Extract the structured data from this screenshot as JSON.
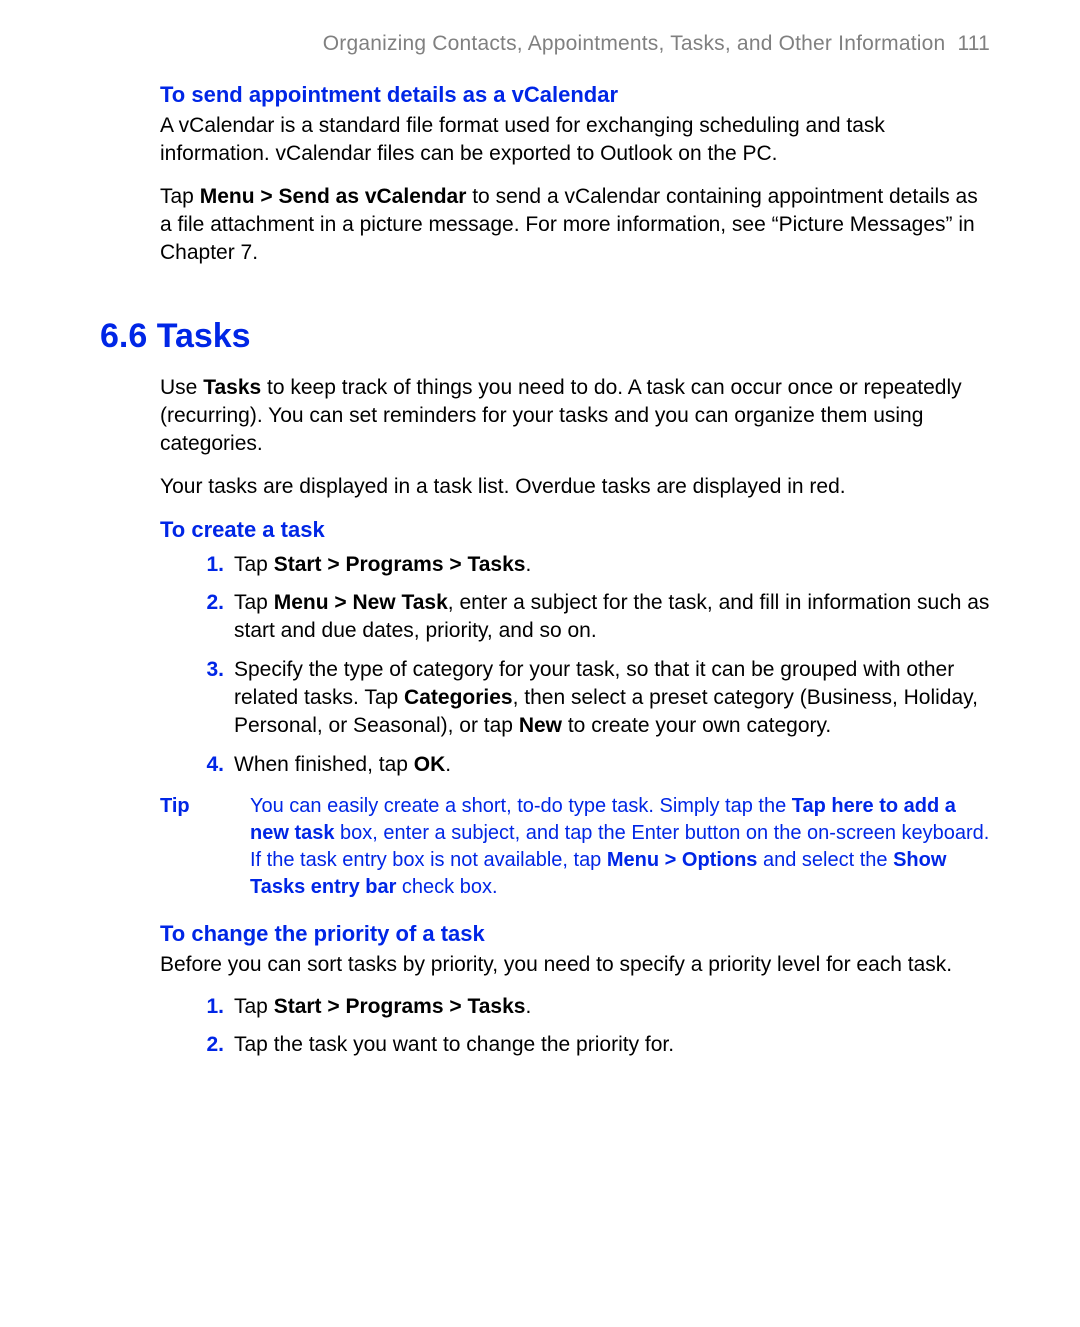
{
  "header": {
    "running_title": "Organizing Contacts, Appointments, Tasks, and Other Information",
    "page_number": "111"
  },
  "vcal": {
    "heading": "To send appointment details as a vCalendar",
    "p1": "A vCalendar is a standard file format used for exchanging scheduling and task information. vCalendar files can be exported to Outlook on the PC.",
    "p2_pre": "Tap ",
    "p2_bold": "Menu > Send as vCalendar",
    "p2_post": " to send a vCalendar containing appointment details as a file attachment in a picture message. For more information, see “Picture Messages” in Chapter 7."
  },
  "section": {
    "title": "6.6 Tasks"
  },
  "tasks_intro": {
    "p1_pre": "Use ",
    "p1_bold": "Tasks",
    "p1_post": " to keep track of things you need to do. A task can occur once or repeatedly (recurring). You can set reminders for your tasks and you can organize them using categories.",
    "p2": "Your tasks are displayed in a task list. Overdue tasks are displayed in red."
  },
  "create": {
    "heading": "To create a task",
    "items": [
      {
        "num": "1.",
        "pre": "Tap ",
        "b1": "Start > Programs > Tasks",
        "post": "."
      },
      {
        "num": "2.",
        "pre": "Tap ",
        "b1": "Menu > New Task",
        "post": ", enter a subject for the task, and fill in information such as start and due dates, priority, and so on."
      },
      {
        "num": "3.",
        "pre": "Specify the type of category for your task, so that it can be grouped with other related tasks. Tap ",
        "b1": "Categories",
        "mid": ", then select a preset category (Business, Holiday, Personal, or Seasonal), or tap ",
        "b2": "New",
        "post": " to create your own category."
      },
      {
        "num": "4.",
        "pre": "When finished, tap ",
        "b1": "OK",
        "post": "."
      }
    ]
  },
  "tip": {
    "label": "Tip",
    "t1": "You can easily create a short, to-do type task. Simply tap the ",
    "b1": "Tap here to add a new task",
    "t2": " box, enter a subject, and tap the Enter button on the on-screen keyboard. If the task entry box is not available, tap ",
    "b2": "Menu > Options",
    "t3": " and select the ",
    "b3": "Show Tasks entry bar",
    "t4": " check box."
  },
  "priority": {
    "heading": "To change the priority of a task",
    "p1": "Before you can sort tasks by priority, you need to specify a priority level for each task.",
    "items": [
      {
        "num": "1.",
        "pre": "Tap ",
        "b1": "Start > Programs > Tasks",
        "post": "."
      },
      {
        "num": "2.",
        "pre": "Tap the task you want to change the priority for.",
        "b1": "",
        "post": ""
      }
    ]
  }
}
